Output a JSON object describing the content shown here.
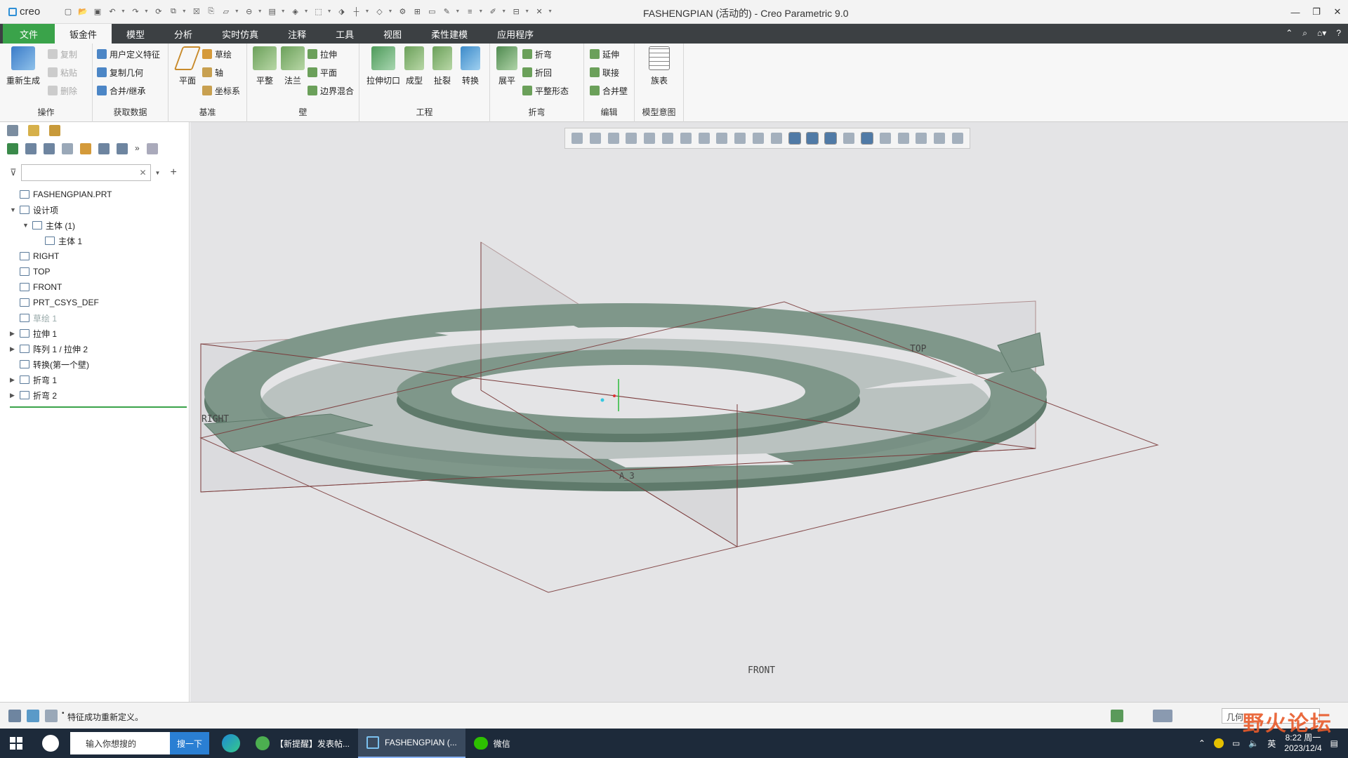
{
  "app": {
    "logo_text": "creo",
    "window_title": "FASHENGPIAN (活动的) - Creo Parametric 9.0"
  },
  "tabs": [
    {
      "label": "文件"
    },
    {
      "label": "钣金件"
    },
    {
      "label": "模型"
    },
    {
      "label": "分析"
    },
    {
      "label": "实时仿真"
    },
    {
      "label": "注释"
    },
    {
      "label": "工具"
    },
    {
      "label": "视图"
    },
    {
      "label": "柔性建模"
    },
    {
      "label": "应用程序"
    }
  ],
  "ribbon": {
    "operations": {
      "label": "操作",
      "regen": "重新生成",
      "copy": "复制",
      "paste": "粘贴",
      "delete": "删除"
    },
    "get_data": {
      "label": "获取数据",
      "udf": "用户定义特征",
      "copy_geom": "复制几何",
      "merge": "合并/继承"
    },
    "datum": {
      "label": "基准",
      "plane": "平面",
      "sketch": "草绘",
      "axis": "轴",
      "csys": "坐标系"
    },
    "wall": {
      "label": "壁",
      "flat": "平整",
      "flange": "法兰",
      "extrude": "拉伸",
      "planar": "平面",
      "boundary_blend": "边界混合"
    },
    "engineering": {
      "label": "工程",
      "extrude_cut": "拉伸切口",
      "form": "成型",
      "rip": "扯裂",
      "convert": "转换"
    },
    "bend": {
      "label": "折弯",
      "unbend": "展平",
      "bend": "折弯",
      "bend_back": "折回",
      "flatten_form": "平整形态"
    },
    "edit": {
      "label": "编辑",
      "extend": "延伸",
      "join": "联接",
      "merge_wall": "合并壁"
    },
    "intent": {
      "label": "模型意图",
      "family_table": "族表"
    }
  },
  "model_tree": {
    "filter_placeholder": "",
    "nodes": [
      {
        "label": "FASHENGPIAN.PRT",
        "indent": 0,
        "toggle": ""
      },
      {
        "label": "设计项",
        "indent": 0,
        "toggle": "▼"
      },
      {
        "label": "主体 (1)",
        "indent": 1,
        "toggle": "▼"
      },
      {
        "label": "主体 1",
        "indent": 2,
        "toggle": ""
      },
      {
        "label": "RIGHT",
        "indent": 0,
        "toggle": ""
      },
      {
        "label": "TOP",
        "indent": 0,
        "toggle": ""
      },
      {
        "label": "FRONT",
        "indent": 0,
        "toggle": ""
      },
      {
        "label": "PRT_CSYS_DEF",
        "indent": 0,
        "toggle": ""
      },
      {
        "label": "草绘 1",
        "indent": 0,
        "toggle": "",
        "dim": true
      },
      {
        "label": "拉伸 1",
        "indent": 0,
        "toggle": "▶"
      },
      {
        "label": "阵列 1 / 拉伸 2",
        "indent": 0,
        "toggle": "▶"
      },
      {
        "label": "转换(第一个壁)",
        "indent": 0,
        "toggle": ""
      },
      {
        "label": "折弯 1",
        "indent": 0,
        "toggle": "▶"
      },
      {
        "label": "折弯 2",
        "indent": 0,
        "toggle": "▶"
      }
    ]
  },
  "viewport": {
    "labels": {
      "top": "TOP",
      "right": "RIGHT",
      "front": "FRONT",
      "axis": "A_3"
    },
    "colors": {
      "background": "#e4e4e6",
      "part": "#7f978a",
      "part_dark": "#5f7a6b",
      "datum_line": "#7a3a3a"
    }
  },
  "status": {
    "message": "特征成功重新定义。",
    "filter": "几何"
  },
  "taskbar": {
    "search_placeholder": "输入你想搜的",
    "search_button": "搜一下",
    "apps": [
      {
        "label": "【新提醒】发表帖...",
        "active": false
      },
      {
        "label": "FASHENGPIAN (...",
        "active": true
      },
      {
        "label": "微信",
        "active": false
      }
    ],
    "ime": "英",
    "time": "8:22 周一",
    "date": "2023/12/4"
  },
  "watermark": "野火论坛"
}
